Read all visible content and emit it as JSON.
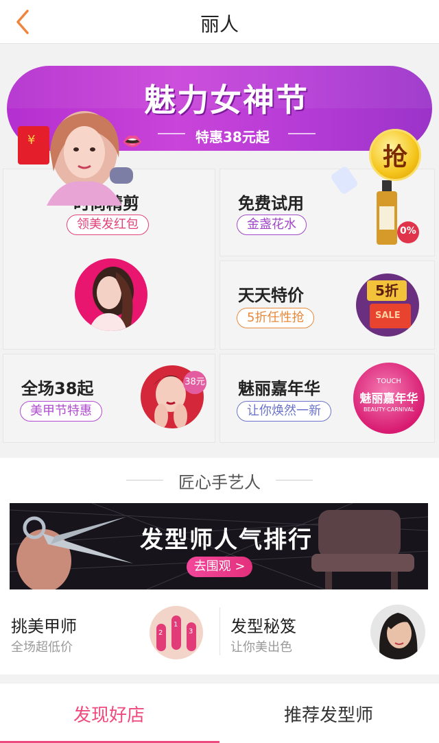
{
  "header": {
    "title": "丽人",
    "back_icon": "chevron-left-icon",
    "back_color": "#f0843a"
  },
  "banner": {
    "title": "魅力女神节",
    "subtitle": "特惠38元起",
    "grab_label": "抢"
  },
  "grid": [
    {
      "title": "时尚精剪",
      "tag": "领美发红包",
      "tag_color": "#e0427a"
    },
    {
      "title": "免费试用",
      "tag": "金盏花水",
      "tag_color": "#a045c9",
      "badge": "0%"
    },
    {
      "title": "天天特价",
      "tag": "5折任性抢",
      "tag_color": "#e8883a",
      "badge": "5折",
      "badge2": "SALE"
    },
    {
      "title": "全场38起",
      "tag": "美甲节特惠",
      "tag_color": "#b04ad0",
      "badge": "38元"
    },
    {
      "title": "魅丽嘉年华",
      "tag": "让你焕然一新",
      "tag_color": "#6a73c9",
      "logo_top": "TOUCH",
      "logo_main": "魅丽嘉年华",
      "logo_sub": "BEAUTY·CARNIVAL"
    }
  ],
  "craft": {
    "section_title": "匠心手艺人",
    "rank_title": "发型师人气排行",
    "rank_button": "去围观 >",
    "items": [
      {
        "title": "挑美甲师",
        "subtitle": "全场超低价"
      },
      {
        "title": "发型秘笈",
        "subtitle": "让你美出色"
      }
    ]
  },
  "tabs": [
    {
      "label": "发现好店",
      "active": true,
      "color": "#ef4a7e"
    },
    {
      "label": "推荐发型师",
      "active": false,
      "color": "#333333"
    }
  ]
}
